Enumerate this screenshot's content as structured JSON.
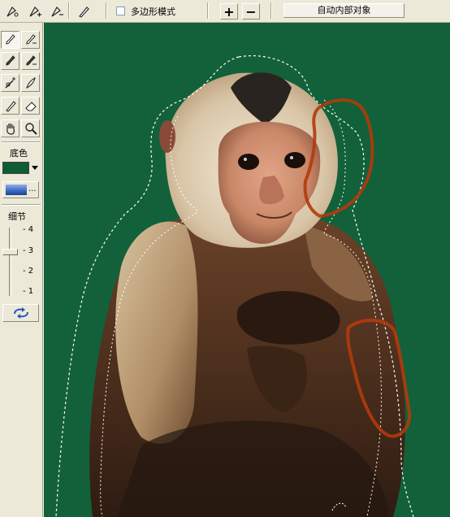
{
  "toolbar": {
    "polygon_mode_label": "多边形模式",
    "polygon_mode_checked": false,
    "zoom_in_label": "+",
    "zoom_out_label": "−",
    "auto_inner_label": "自动内部对象",
    "icons": [
      "lasso-pen-icon",
      "lasso-add-icon",
      "lasso-subtract-icon",
      "pen-icon",
      "zoom-in-icon",
      "zoom-out-icon"
    ]
  },
  "left_panel": {
    "tools": [
      "brush-icon",
      "fill-brush-icon",
      "brush-add-icon",
      "fill-erase-icon",
      "wand-icon",
      "feather-brush-icon",
      "pencil-icon",
      "eraser-icon",
      "hand-icon",
      "magnifier-icon"
    ],
    "background_label": "底色",
    "background_color": "#0f5c35",
    "background_image_dots": "...",
    "detail_label": "细节",
    "detail_ticks": [
      "- 4",
      "- 3",
      "- 2",
      "- 1"
    ],
    "detail_value": 3,
    "refresh_icon": "refresh-arrows-icon"
  },
  "canvas": {
    "background_color": "#12613a",
    "stroke_color": "#b23a0c"
  }
}
